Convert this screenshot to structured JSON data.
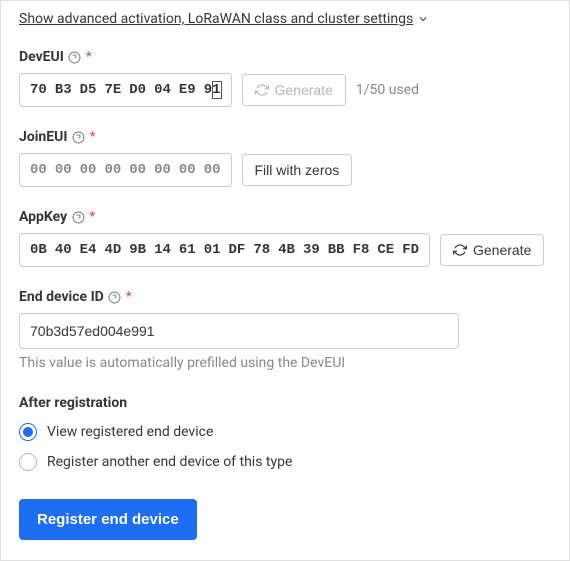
{
  "advanced_link": "Show advanced activation, LoRaWAN class and cluster settings",
  "dev_eui": {
    "label": "DevEUI",
    "bytes": [
      "70",
      "B3",
      "D5",
      "7E",
      "D0",
      "04",
      "E9",
      "91"
    ],
    "generate": "Generate",
    "usage": "1/50 used"
  },
  "join_eui": {
    "label": "JoinEUI",
    "bytes": [
      "00",
      "00",
      "00",
      "00",
      "00",
      "00",
      "00",
      "00"
    ],
    "fill": "Fill with zeros"
  },
  "app_key": {
    "label": "AppKey",
    "bytes": [
      "0B",
      "40",
      "E4",
      "4D",
      "9B",
      "14",
      "61",
      "01",
      "DF",
      "78",
      "4B",
      "39",
      "BB",
      "F8",
      "CE",
      "FD"
    ],
    "generate": "Generate"
  },
  "end_device": {
    "label": "End device ID",
    "value": "70b3d57ed004e991",
    "hint": "This value is automatically prefilled using the DevEUI"
  },
  "after": {
    "title": "After registration",
    "opt1": "View registered end device",
    "opt2": "Register another end device of this type"
  },
  "submit": "Register end device"
}
